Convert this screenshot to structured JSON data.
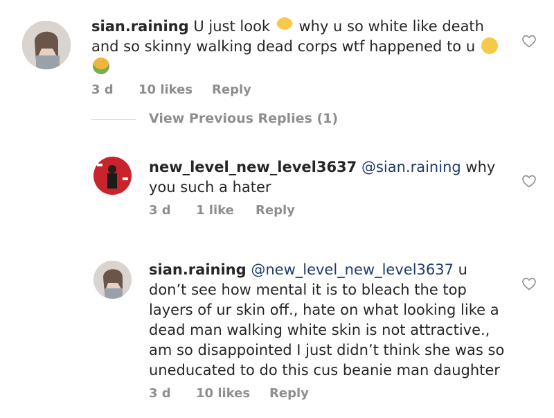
{
  "comments": [
    {
      "username": "sian.raining",
      "text_a": "U just look",
      "emoji_1": "face-with-bandage-emoji",
      "text_b": "why u so white like death and so skinny walking dead corps wtf happened to u",
      "emoji_2": "face-screaming-emoji",
      "emoji_3": "face-vomiting-emoji",
      "time": "3 d",
      "likes": "10 likes",
      "reply": "Reply"
    },
    {
      "username": "new_level_new_level3637",
      "mention": "@sian.raining",
      "text": "why you such a hater",
      "time": "3 d",
      "likes": "1 like",
      "reply": "Reply"
    },
    {
      "username": "sian.raining",
      "mention": "@new_level_new_level3637",
      "text": "u don’t see how mental it is to bleach the top layers of ur skin off., hate on what looking like a dead man walking white skin is not attractive., am so disappointed I just didn’t think she was so uneducated to do this cus beanie man daughter",
      "time": "3 d",
      "likes": "10 likes",
      "reply": "Reply"
    }
  ],
  "view_previous": "View Previous Replies (1)",
  "icons": {
    "like": "heart-outline-icon"
  },
  "colors": {
    "text": "#262626",
    "meta": "#8e8e8e",
    "mention": "#1d3b6e"
  }
}
